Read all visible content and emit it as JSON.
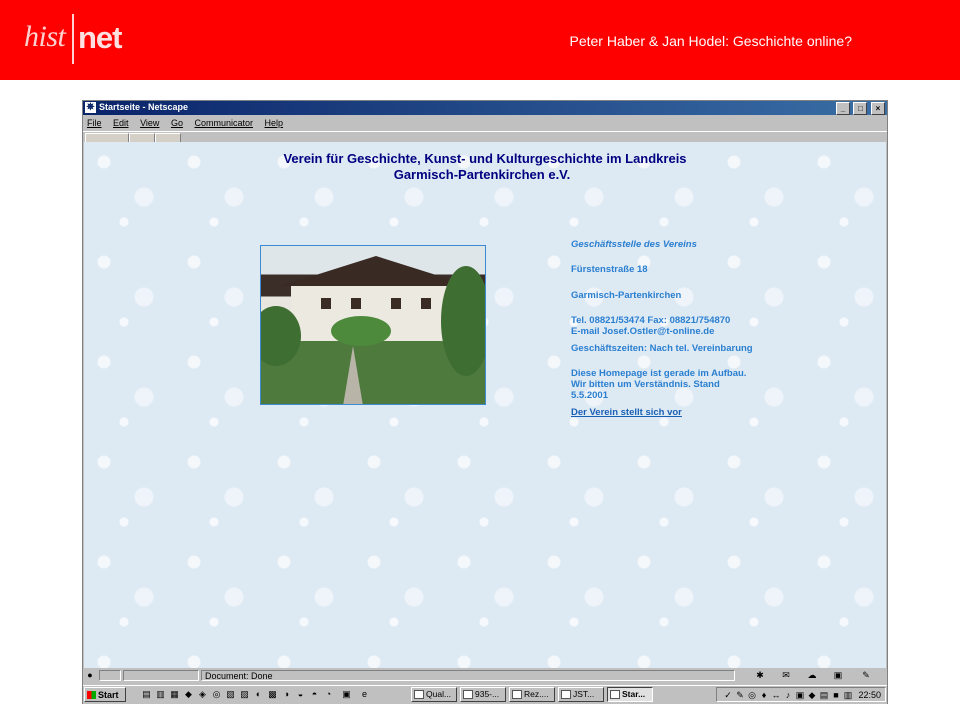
{
  "slide": {
    "logo_hist": "hist",
    "logo_net": "net",
    "subtitle": "Peter Haber & Jan Hodel: Geschichte online?",
    "header_color": "#ff0000"
  },
  "window": {
    "title": "Startseite - Netscape",
    "buttons": [
      "_",
      "□",
      "×"
    ],
    "menu": [
      "File",
      "Edit",
      "View",
      "Go",
      "Communicator",
      "Help"
    ]
  },
  "page": {
    "heading_line1": "Verein für Geschichte, Kunst- und Kulturgeschichte im Landkreis",
    "heading_line2": "Garmisch-Partenkirchen e.V.",
    "info": {
      "office_title": "Geschäftsstelle des Vereins",
      "street": "Fürstenstraße 18",
      "city": "Garmisch-Partenkirchen",
      "phone": "Tel. 08821/53474 Fax: 08821/754870",
      "email": "E-mail Josef.Ostler@t-online.de",
      "hours": "Geschäftszeiten: Nach tel. Vereinbarung",
      "notice_line1": "Diese Homepage ist gerade im Aufbau.",
      "notice_line2": "Wir bitten um Verständnis. Stand",
      "notice_line3": "5.5.2001",
      "link": "Der Verein stellt sich vor"
    }
  },
  "statusbar": {
    "status": "Document: Done"
  },
  "taskbar": {
    "start": "Start",
    "tasks": [
      "Qual...",
      "935-...",
      "Rez....",
      "JST...",
      "Star..."
    ],
    "active_task": "Star...",
    "clock": "22:50"
  }
}
